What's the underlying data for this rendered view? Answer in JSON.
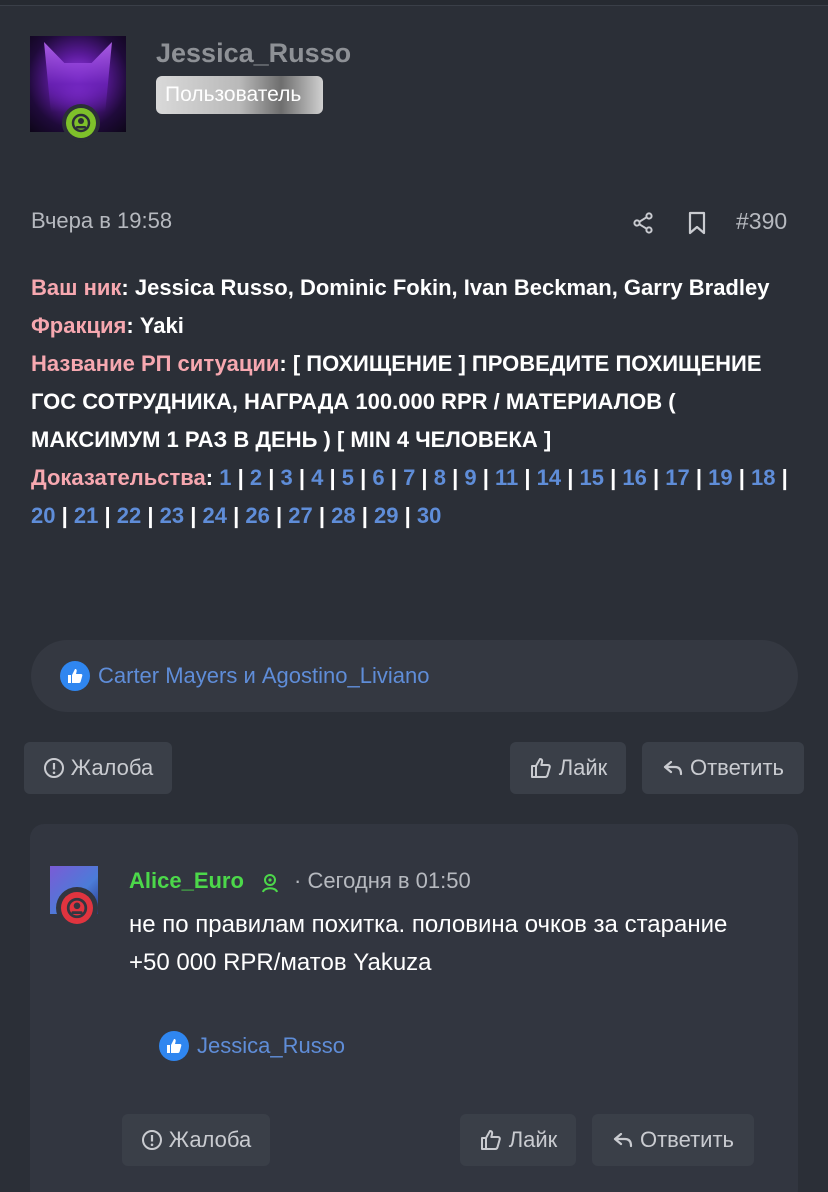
{
  "post": {
    "author": "Jessica_Russo",
    "role": "Пользователь",
    "date": "Вчера в 19:58",
    "number": "#390",
    "fields": {
      "nick_label": "Ваш ник",
      "nick_value": "Jessica Russo, Dominic Fokin, Ivan Beckman, Garry Bradley",
      "faction_label": "Фракция",
      "faction_value": "Yaki",
      "rp_label": "Название РП ситуации",
      "rp_value": "[ ПОХИЩЕНИЕ ] ПРОВЕДИТЕ ПОХИЩЕНИЕ ГОС СОТРУДНИКА, НАГРАДА 100.000 RPR / МАТЕРИАЛОВ ( МАКСИМУМ 1 РАЗ В ДЕНЬ ) [ MIN 4 ЧЕЛОВЕКА ]",
      "proof_label": "Доказательства"
    },
    "proof_links": [
      "1",
      "2",
      "3",
      "4",
      "5",
      "6",
      "7",
      "8",
      "9",
      "11",
      "14",
      "15",
      "16",
      "17",
      "19",
      "18",
      "20",
      "21",
      "22",
      "23",
      "24",
      "26",
      "27",
      "28",
      "29",
      "30"
    ],
    "reactions_text": "Carter Mayers и Agostino_Liviano",
    "actions": {
      "report": "Жалоба",
      "like": "Лайк",
      "reply": "Ответить"
    }
  },
  "comment": {
    "author": "Alice_Euro",
    "date": "· Сегодня в 01:50",
    "text": "не по правилам похитка. половина очков за старание +50 000 RPR/матов Yakuza",
    "reactions_text": "Jessica_Russo",
    "actions": {
      "report": "Жалоба",
      "like": "Лайк",
      "reply": "Ответить"
    }
  },
  "colors": {
    "background": "#2b2f37",
    "label_pink": "#f7a8b0",
    "link_blue": "#5f8dd8",
    "online_green": "#7ec12a",
    "author_green": "#4cd84a",
    "status_red": "#e0343f"
  }
}
